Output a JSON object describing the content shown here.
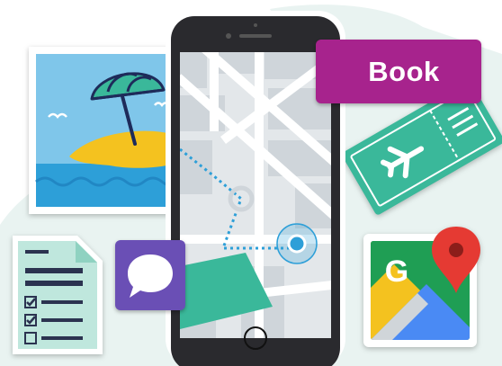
{
  "cta": {
    "label": "Book",
    "color": "#a7238d"
  },
  "maps_card": {
    "letter": "G",
    "icon": "google-maps-icon"
  },
  "icons": {
    "beach_photo": "beach-photo-icon",
    "boarding_pass": "plane-ticket-icon",
    "checklist": "checklist-document-icon",
    "chat": "chat-bubble-icon",
    "location": "location-dot-icon",
    "phone": "smartphone-icon"
  },
  "colors": {
    "teal": "#3ab89a",
    "purple": "#6a4fb5",
    "sky": "#7fc6ea",
    "sea": "#2d9fd8",
    "sand": "#f4c21f",
    "map_bg": "#e3e7ea"
  }
}
